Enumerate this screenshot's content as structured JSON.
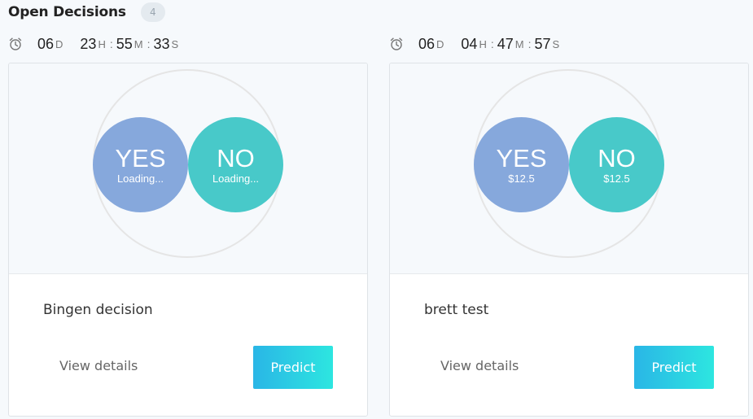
{
  "header": {
    "title": "Open Decisions",
    "count": "4"
  },
  "decisions": [
    {
      "timer": {
        "days": "06",
        "day_unit": "D",
        "hours": "23",
        "hour_unit": "H",
        "minutes": "55",
        "minute_unit": "M",
        "seconds": "33",
        "second_unit": "S"
      },
      "yes": {
        "label": "YES",
        "value": "Loading..."
      },
      "no": {
        "label": "NO",
        "value": "Loading..."
      },
      "title": "Bingen decision",
      "view_details": "View details",
      "predict": "Predict"
    },
    {
      "timer": {
        "days": "06",
        "day_unit": "D",
        "hours": "04",
        "hour_unit": "H",
        "minutes": "47",
        "minute_unit": "M",
        "seconds": "57",
        "second_unit": "S"
      },
      "yes": {
        "label": "YES",
        "value": "$12.5"
      },
      "no": {
        "label": "NO",
        "value": "$12.5"
      },
      "title": "brett test",
      "view_details": "View details",
      "predict": "Predict"
    }
  ],
  "colors": {
    "yes": "#86a8dc",
    "no": "#48c9c9",
    "predict_start": "#2ab6e6",
    "predict_end": "#2de6e0"
  },
  "icons": {
    "timer": "alarm-clock-icon"
  }
}
